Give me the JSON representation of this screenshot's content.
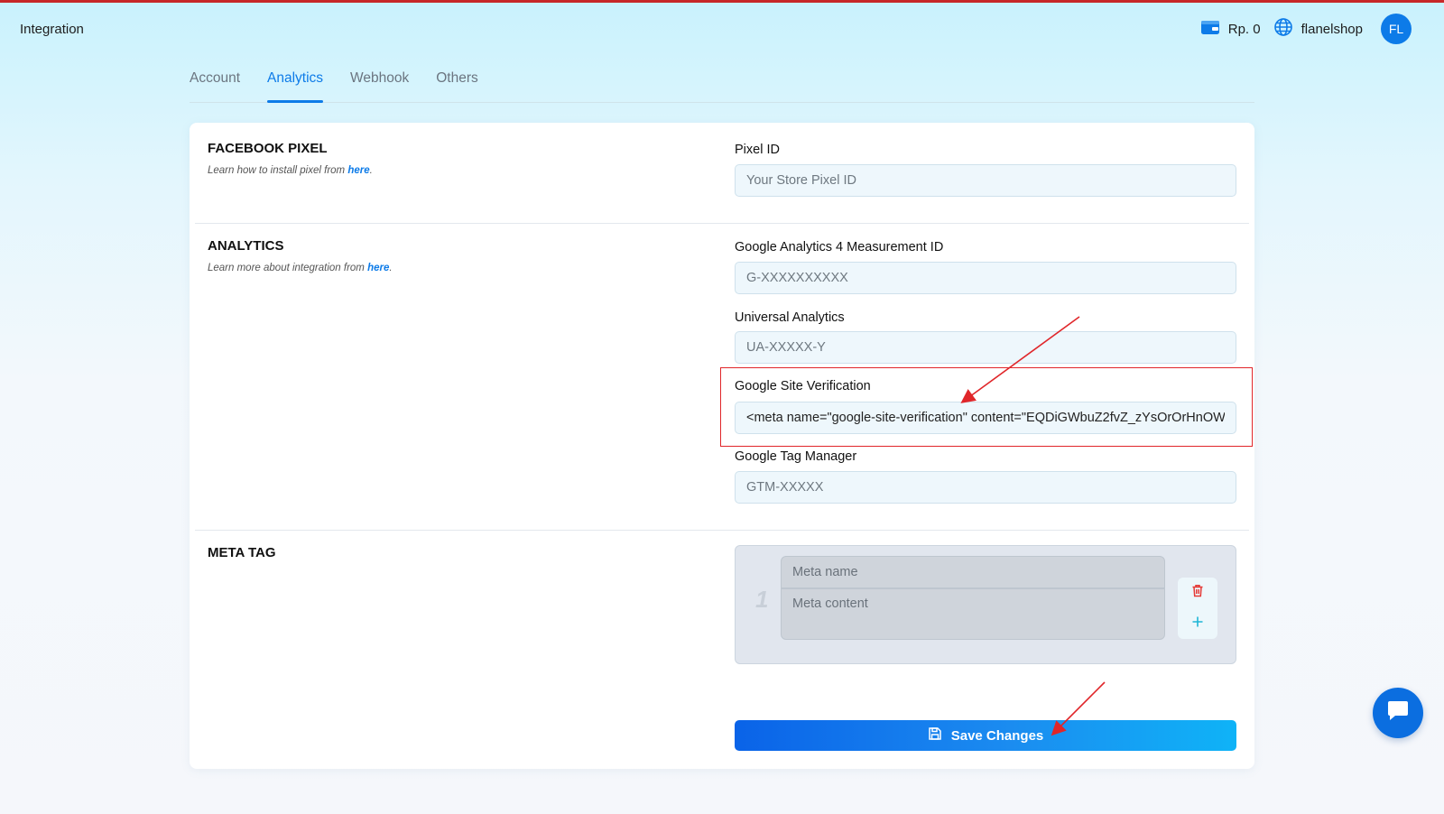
{
  "header": {
    "title": "Integration",
    "balance": "Rp. 0",
    "shop_name": "flanelshop",
    "avatar_initials": "FL",
    "icons": {
      "wallet": "wallet-icon",
      "globe": "globe-icon"
    }
  },
  "tabs": [
    {
      "label": "Account",
      "active": false
    },
    {
      "label": "Analytics",
      "active": true
    },
    {
      "label": "Webhook",
      "active": false
    },
    {
      "label": "Others",
      "active": false
    }
  ],
  "facebook_pixel": {
    "title": "FACEBOOK PIXEL",
    "desc_prefix": "Learn how to install pixel from",
    "desc_link": "here",
    "desc_suffix": ".",
    "pixel_label": "Pixel ID",
    "pixel_placeholder": "Your Store Pixel ID",
    "pixel_value": ""
  },
  "analytics": {
    "title": "ANALYTICS",
    "desc_prefix": "Learn more about integration from",
    "desc_link": "here",
    "desc_suffix": ".",
    "ga4_label": "Google Analytics 4 Measurement ID",
    "ga4_placeholder": "G-XXXXXXXXXX",
    "ua_label": "Universal Analytics",
    "ua_placeholder": "UA-XXXXX-Y",
    "gsv_label": "Google Site Verification",
    "gsv_value": "<meta name=\"google-site-verification\" content=\"EQDiGWbuZ2fvZ_zYsOrOrHnOW",
    "gtm_label": "Google Tag Manager",
    "gtm_placeholder": "GTM-XXXXX"
  },
  "meta_tag": {
    "title": "META TAG",
    "rows": [
      {
        "index": "1",
        "name_placeholder": "Meta name",
        "content_placeholder": "Meta content"
      }
    ]
  },
  "save_button": {
    "label": "Save Changes",
    "icon": "save-icon"
  },
  "colors": {
    "accent": "#0d7be8",
    "annotation_red": "#e0262a",
    "delete_red": "#e53935",
    "add_cyan": "#1fb6d6"
  }
}
